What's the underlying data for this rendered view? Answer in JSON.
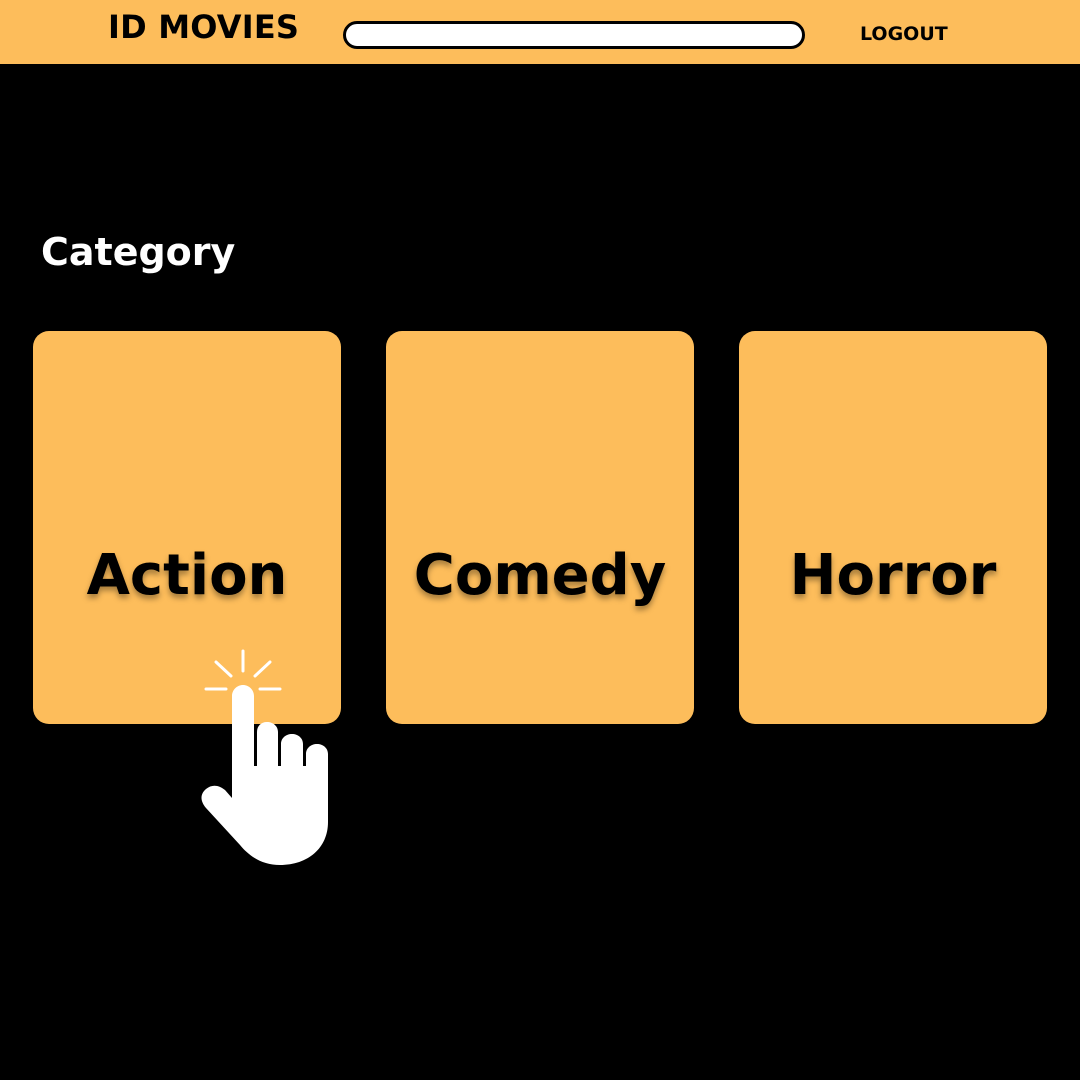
{
  "header": {
    "brand": "ID MOVIES",
    "search_value": "",
    "logout_label": "LOGOUT",
    "accent_color": "#FDBD5B"
  },
  "main": {
    "section_title": "Category",
    "categories": [
      {
        "label": "Action"
      },
      {
        "label": "Comedy"
      },
      {
        "label": "Horror"
      }
    ]
  },
  "overlay": {
    "pointer_icon": "hand-pointer-click-icon"
  }
}
